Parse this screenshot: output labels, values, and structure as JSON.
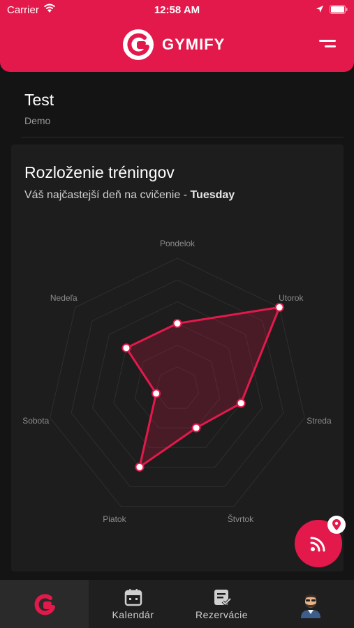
{
  "status_bar": {
    "carrier": "Carrier",
    "time": "12:58 AM"
  },
  "header": {
    "logo_text": "GYMIFY",
    "accent_color": "#e4194b",
    "menu_icon": "hamburger-menu-icon"
  },
  "profile": {
    "title": "Test",
    "subtitle": "Demo"
  },
  "card": {
    "title": "Rozloženie tréningov",
    "subtitle_prefix": "Váš najčastejší deň na cvičenie - ",
    "subtitle_highlight": "Tuesday"
  },
  "chart_data": {
    "type": "radar",
    "axes": [
      "Pondelok",
      "Utorok",
      "Streda",
      "Štvrtok",
      "Piatok",
      "Sobota",
      "Nedeľa"
    ],
    "values": [
      3,
      6,
      3,
      2,
      4,
      1,
      3
    ],
    "rmax": 6,
    "rings": 6,
    "series_color": "#e4194b",
    "fill_color": "rgba(228,25,75,0.22)",
    "grid": true
  },
  "fab": {
    "icon": "rss-feed-icon",
    "badge_icon": "location-pin-icon"
  },
  "tabbar": {
    "tabs": [
      {
        "label": "",
        "icon": "gymify-logo-icon",
        "active": true
      },
      {
        "label": "Kalendár",
        "icon": "calendar-icon",
        "active": false
      },
      {
        "label": "Rezervácie",
        "icon": "reservations-icon",
        "active": false
      },
      {
        "label": "",
        "icon": "avatar-icon",
        "active": false
      }
    ]
  }
}
